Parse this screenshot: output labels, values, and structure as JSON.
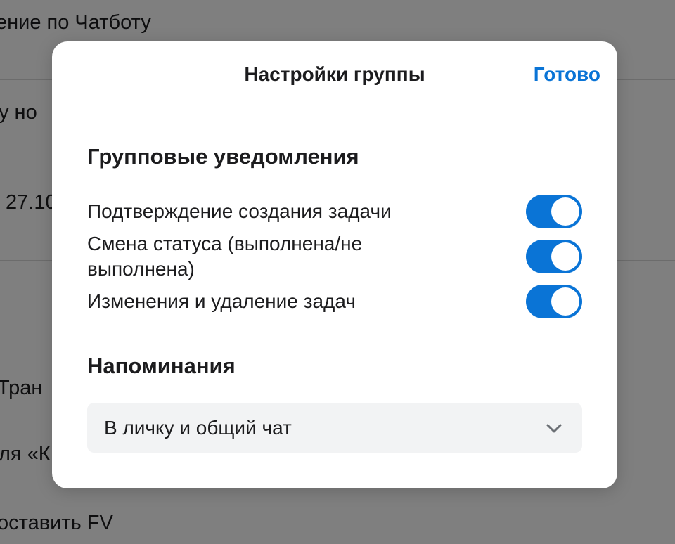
{
  "background": {
    "rows": [
      "ение по Чатботу",
      "у но",
      "27.10",
      "Тран",
      "ля «К",
      "оставить FV"
    ]
  },
  "modal": {
    "title": "Настройки группы",
    "done_label": "Готово",
    "group_notifications": {
      "title": "Групповые уведомления",
      "items": [
        {
          "label": "Подтверждение создания задачи",
          "enabled": true
        },
        {
          "label": "Смена статуса (выполнена/не выполнена)",
          "enabled": true
        },
        {
          "label": "Изменения и удаление задач",
          "enabled": true
        }
      ]
    },
    "reminders": {
      "title": "Напоминания",
      "selected": "В личку и общий чат"
    }
  },
  "colors": {
    "accent": "#0a74d6",
    "overlay": "#808080"
  }
}
